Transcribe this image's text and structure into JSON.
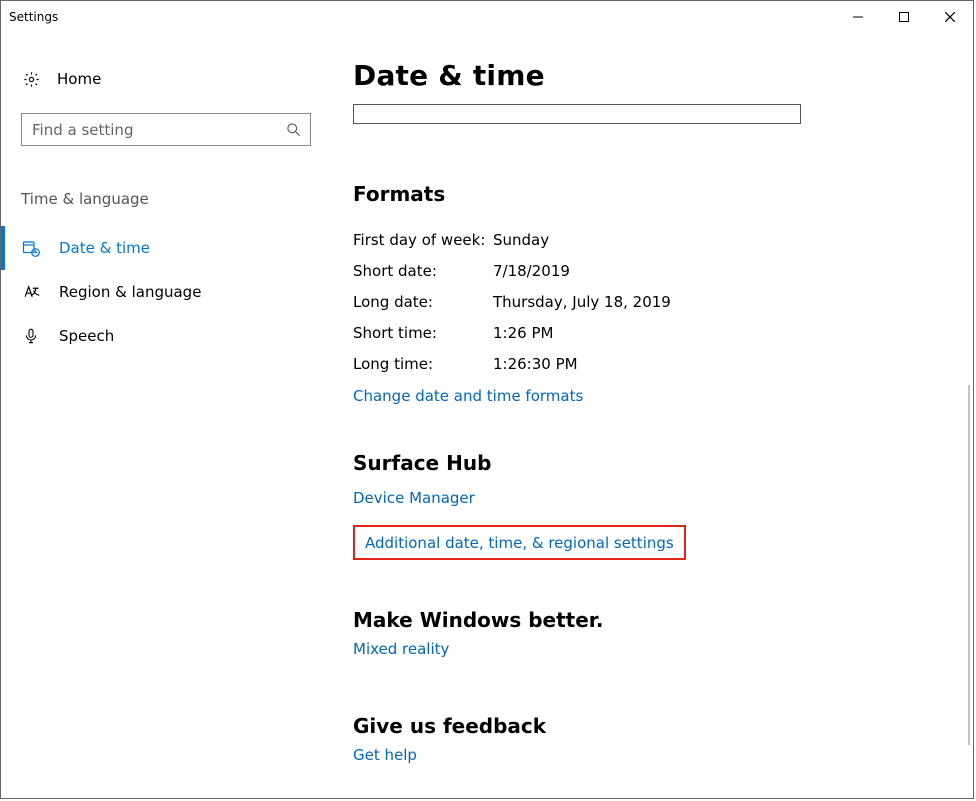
{
  "window": {
    "title": "Settings"
  },
  "sidebar": {
    "home": "Home",
    "search_placeholder": "Find a setting",
    "category": "Time & language",
    "items": [
      {
        "label": "Date & time",
        "active": true
      },
      {
        "label": "Region & language"
      },
      {
        "label": "Speech"
      }
    ]
  },
  "main": {
    "title": "Date & time",
    "formats": {
      "heading": "Formats",
      "rows": [
        {
          "k": "First day of week:",
          "v": "Sunday"
        },
        {
          "k": "Short date:",
          "v": "7/18/2019"
        },
        {
          "k": "Long date:",
          "v": "Thursday, July 18, 2019"
        },
        {
          "k": "Short time:",
          "v": "1:26 PM"
        },
        {
          "k": "Long time:",
          "v": "1:26:30 PM"
        }
      ],
      "change_link": "Change date and time formats"
    },
    "surface_hub": {
      "heading": "Surface Hub",
      "device_manager": "Device Manager",
      "additional": "Additional date, time, & regional settings"
    },
    "better": {
      "heading": "Make Windows better.",
      "link": "Mixed reality"
    },
    "feedback": {
      "heading": "Give us feedback",
      "link": "Get help"
    }
  }
}
